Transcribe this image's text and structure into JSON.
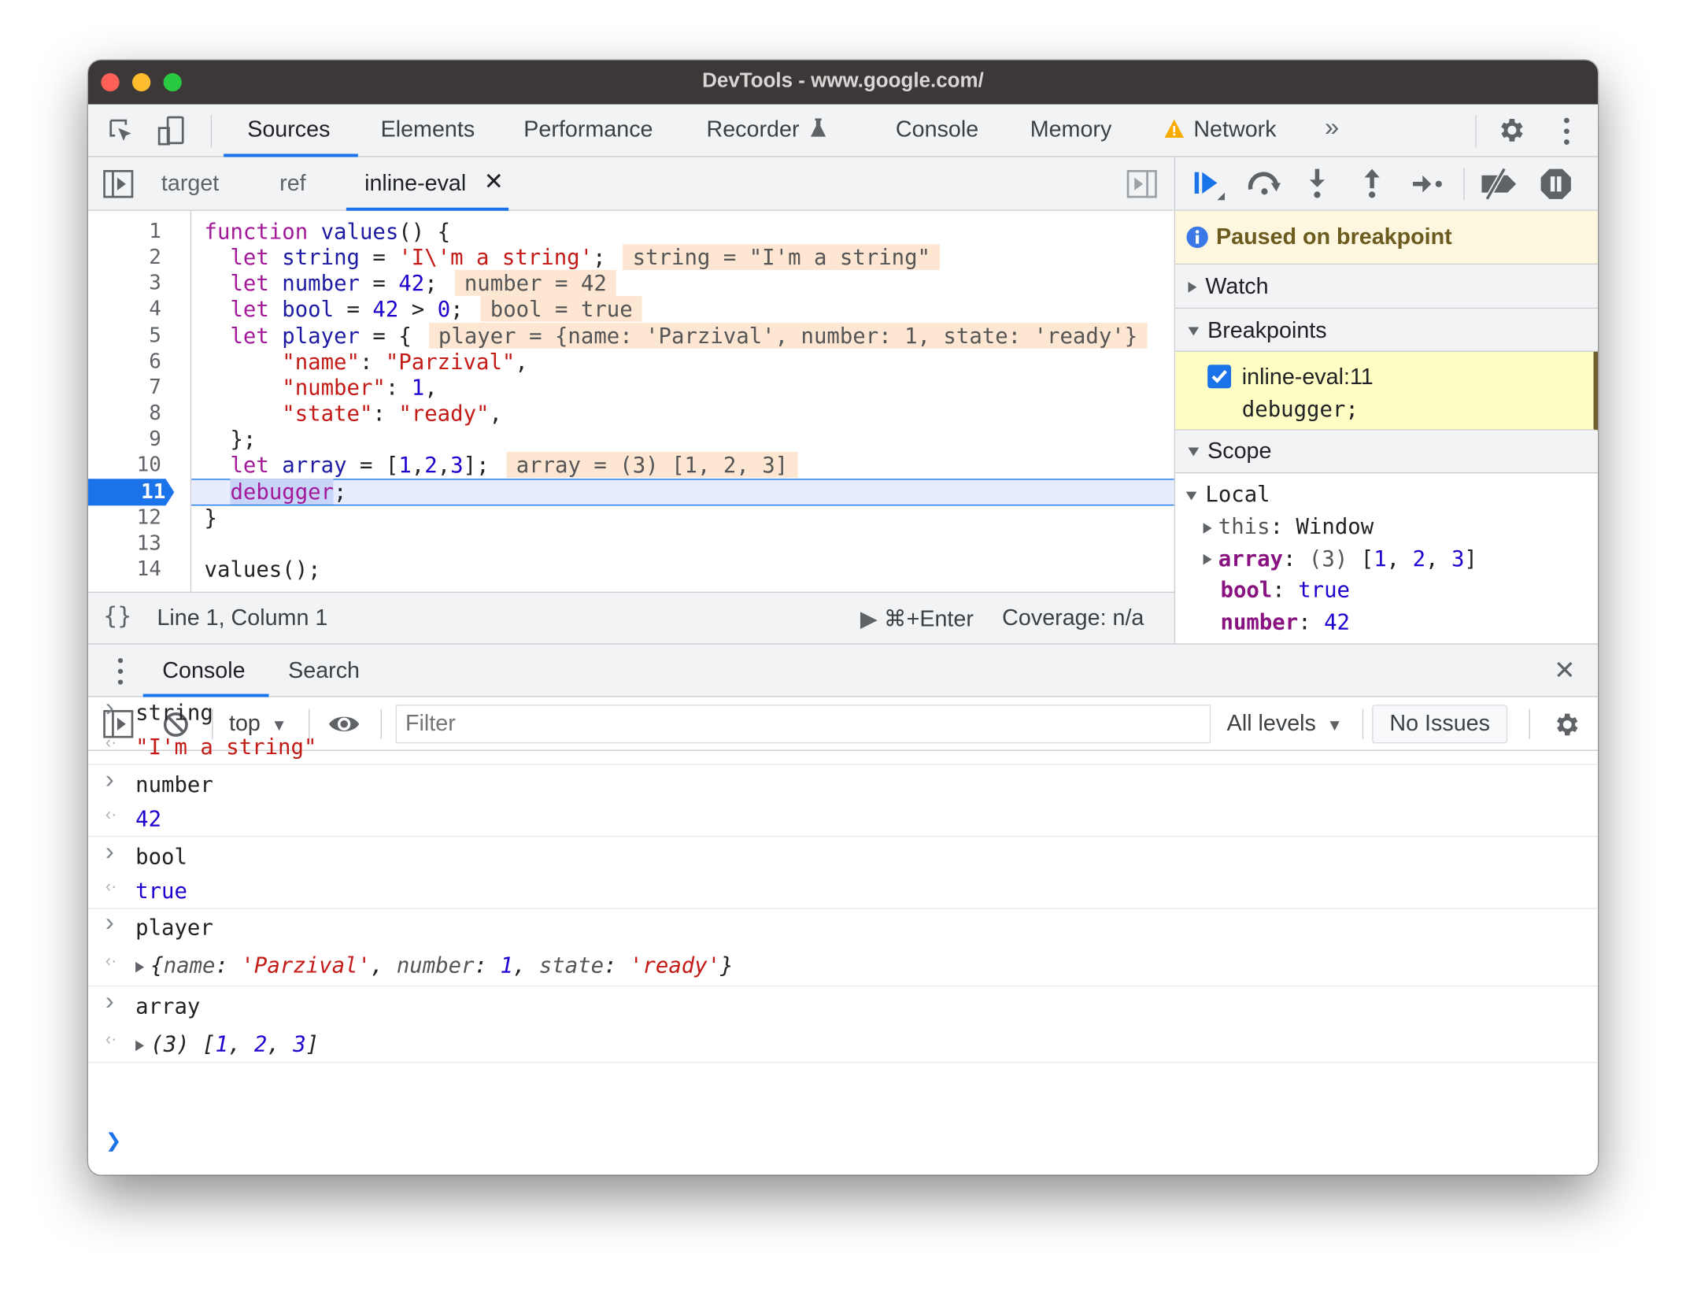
{
  "window": {
    "title": "DevTools - www.google.com/"
  },
  "main_tabs": [
    "Sources",
    "Elements",
    "Performance",
    "Recorder",
    "Console",
    "Memory",
    "Network"
  ],
  "active_tab": "Sources",
  "more_tabs_icon": "chevron-double-right",
  "file_tabs": [
    {
      "label": "target"
    },
    {
      "label": "ref"
    },
    {
      "label": "inline-eval",
      "active": true,
      "closable": true
    }
  ],
  "code": {
    "current_line": "11",
    "lines": [
      {
        "n": "1",
        "t": [
          [
            "k",
            "function"
          ],
          [
            "p",
            " "
          ],
          [
            "d",
            "values"
          ],
          [
            "p",
            "() {"
          ]
        ]
      },
      {
        "n": "2",
        "t": [
          [
            "p",
            "  "
          ],
          [
            "k",
            "let"
          ],
          [
            "p",
            " "
          ],
          [
            "d",
            "string"
          ],
          [
            "p",
            " = "
          ],
          [
            "s",
            "'I\\'m a string'"
          ],
          [
            "p",
            ";"
          ]
        ],
        "a": "string = \"I'm a string\""
      },
      {
        "n": "3",
        "t": [
          [
            "p",
            "  "
          ],
          [
            "k",
            "let"
          ],
          [
            "p",
            " "
          ],
          [
            "d",
            "number"
          ],
          [
            "p",
            " = "
          ],
          [
            "n",
            "42"
          ],
          [
            "p",
            ";"
          ]
        ],
        "a": "number = 42"
      },
      {
        "n": "4",
        "t": [
          [
            "p",
            "  "
          ],
          [
            "k",
            "let"
          ],
          [
            "p",
            " "
          ],
          [
            "d",
            "bool"
          ],
          [
            "p",
            " = "
          ],
          [
            "n",
            "42"
          ],
          [
            "p",
            " > "
          ],
          [
            "n",
            "0"
          ],
          [
            "p",
            ";"
          ]
        ],
        "a": "bool = true"
      },
      {
        "n": "5",
        "t": [
          [
            "p",
            "  "
          ],
          [
            "k",
            "let"
          ],
          [
            "p",
            " "
          ],
          [
            "d",
            "player"
          ],
          [
            "p",
            " = {"
          ]
        ],
        "a": "player = {name: 'Parzival', number: 1, state: 'ready'}"
      },
      {
        "n": "6",
        "t": [
          [
            "p",
            "      "
          ],
          [
            "s",
            "\"name\""
          ],
          [
            "p",
            ": "
          ],
          [
            "s",
            "\"Parzival\""
          ],
          [
            "p",
            ","
          ]
        ]
      },
      {
        "n": "7",
        "t": [
          [
            "p",
            "      "
          ],
          [
            "s",
            "\"number\""
          ],
          [
            "p",
            ": "
          ],
          [
            "n",
            "1"
          ],
          [
            "p",
            ","
          ]
        ]
      },
      {
        "n": "8",
        "t": [
          [
            "p",
            "      "
          ],
          [
            "s",
            "\"state\""
          ],
          [
            "p",
            ": "
          ],
          [
            "s",
            "\"ready\""
          ],
          [
            "p",
            ","
          ]
        ]
      },
      {
        "n": "9",
        "t": [
          [
            "p",
            "  };"
          ]
        ]
      },
      {
        "n": "10",
        "t": [
          [
            "p",
            "  "
          ],
          [
            "k",
            "let"
          ],
          [
            "p",
            " "
          ],
          [
            "d",
            "array"
          ],
          [
            "p",
            " = ["
          ],
          [
            "n",
            "1"
          ],
          [
            "p",
            ","
          ],
          [
            "n",
            "2"
          ],
          [
            "p",
            ","
          ],
          [
            "n",
            "3"
          ],
          [
            "p",
            "];"
          ]
        ],
        "a": "array = (3) [1, 2, 3]"
      },
      {
        "n": "11",
        "t": [
          [
            "p",
            "  "
          ],
          [
            "k",
            "debugger"
          ],
          [
            "p",
            ";"
          ]
        ]
      },
      {
        "n": "12",
        "t": [
          [
            "p",
            "}"
          ]
        ]
      },
      {
        "n": "13",
        "t": []
      },
      {
        "n": "14",
        "t": [
          [
            "p",
            "values();"
          ]
        ]
      }
    ]
  },
  "status": {
    "position": "Line 1, Column 1",
    "run": "⌘+Enter",
    "coverage": "Coverage: n/a"
  },
  "debugger": {
    "paused": "Paused on breakpoint",
    "watch": "Watch",
    "breakpoints": "Breakpoints",
    "breakpoint_item": {
      "location": "inline-eval:11",
      "code": "debugger;",
      "checked": true
    },
    "scope": "Scope",
    "local": "Local",
    "vars": [
      {
        "name": "this",
        "value": "Window",
        "expandable": true
      },
      {
        "name": "array",
        "value": "(3) [1, 2, 3]",
        "expandable": true
      },
      {
        "name": "bool",
        "value": "true"
      },
      {
        "name": "number",
        "value": "42"
      }
    ]
  },
  "drawer": {
    "tabs": [
      "Console",
      "Search"
    ],
    "active": "Console"
  },
  "console_toolbar": {
    "context": "top",
    "filter_placeholder": "Filter",
    "levels": "All levels",
    "issues": "No Issues"
  },
  "console": [
    {
      "input": "string",
      "output": [
        [
          "s",
          "\"I'm a string\""
        ]
      ]
    },
    {
      "input": "number",
      "output": [
        [
          "n",
          "42"
        ]
      ]
    },
    {
      "input": "bool",
      "output": [
        [
          "n",
          "true"
        ]
      ]
    },
    {
      "input": "player",
      "expandable": true,
      "output": [
        [
          "p",
          "{"
        ],
        [
          "g",
          "name"
        ],
        [
          "p",
          ": "
        ],
        [
          "s",
          "'Parzival'"
        ],
        [
          "p",
          ", "
        ],
        [
          "g",
          "number"
        ],
        [
          "p",
          ": "
        ],
        [
          "n",
          "1"
        ],
        [
          "p",
          ", "
        ],
        [
          "g",
          "state"
        ],
        [
          "p",
          ": "
        ],
        [
          "s",
          "'ready'"
        ],
        [
          "p",
          "}"
        ]
      ]
    },
    {
      "input": "array",
      "expandable": true,
      "output": [
        [
          "p",
          "(3) ["
        ],
        [
          "n",
          "1"
        ],
        [
          "p",
          ", "
        ],
        [
          "n",
          "2"
        ],
        [
          "p",
          ", "
        ],
        [
          "n",
          "3"
        ],
        [
          "p",
          "]"
        ]
      ]
    }
  ],
  "colors": {
    "accent": "#1a73e8",
    "paused_bg": "#fef7e0",
    "breakpoint_bg": "#fefdc4",
    "annotation_bg": "#fde6d2",
    "warning": "#f9ab00"
  }
}
